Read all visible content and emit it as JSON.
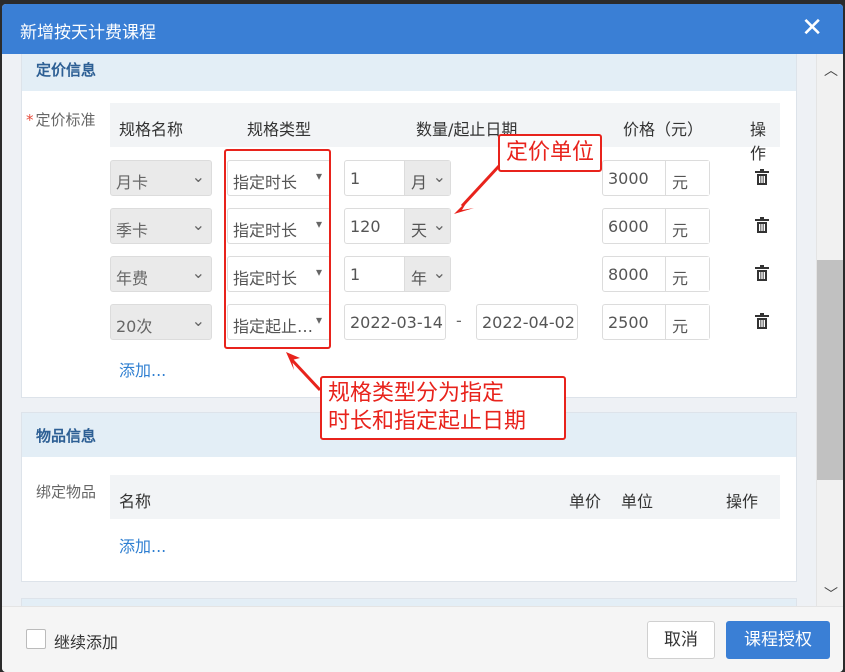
{
  "dialog": {
    "title": "新增按天计费课程",
    "close_label": "✕"
  },
  "pricing": {
    "section_title": "定价信息",
    "field_label": "定价标准",
    "required_mark": "*",
    "columns": [
      "规格名称",
      "规格类型",
      "数量/起止日期",
      "价格（元）",
      "操作"
    ],
    "rows": [
      {
        "name": "月卡",
        "type": "指定时长",
        "qty": "1",
        "unit": "月",
        "price": "3000",
        "currency": "元"
      },
      {
        "name": "季卡",
        "type": "指定时长",
        "qty": "120",
        "unit": "天",
        "price": "6000",
        "currency": "元"
      },
      {
        "name": "年费",
        "type": "指定时长",
        "qty": "1",
        "unit": "年",
        "price": "8000",
        "currency": "元"
      },
      {
        "name": "20次",
        "type": "指定起止…",
        "start": "2022-03-14",
        "sep": "-",
        "end": "2022-04-02",
        "price": "2500",
        "currency": "元"
      }
    ],
    "add_label": "添加..."
  },
  "items": {
    "section_title": "物品信息",
    "field_label": "绑定物品",
    "columns": [
      "名称",
      "单价",
      "单位",
      "操作"
    ],
    "add_label": "添加..."
  },
  "annotations": {
    "unit_note": "定价单位",
    "type_note_line1": "规格类型分为指定",
    "type_note_line2": "时长和指定起止日期"
  },
  "footer": {
    "continue_label": "继续添加",
    "cancel_label": "取消",
    "confirm_label": "课程授权"
  },
  "colors": {
    "primary": "#3a7fd5",
    "annotation": "#e8231c",
    "section_header": "#e3eef6"
  }
}
